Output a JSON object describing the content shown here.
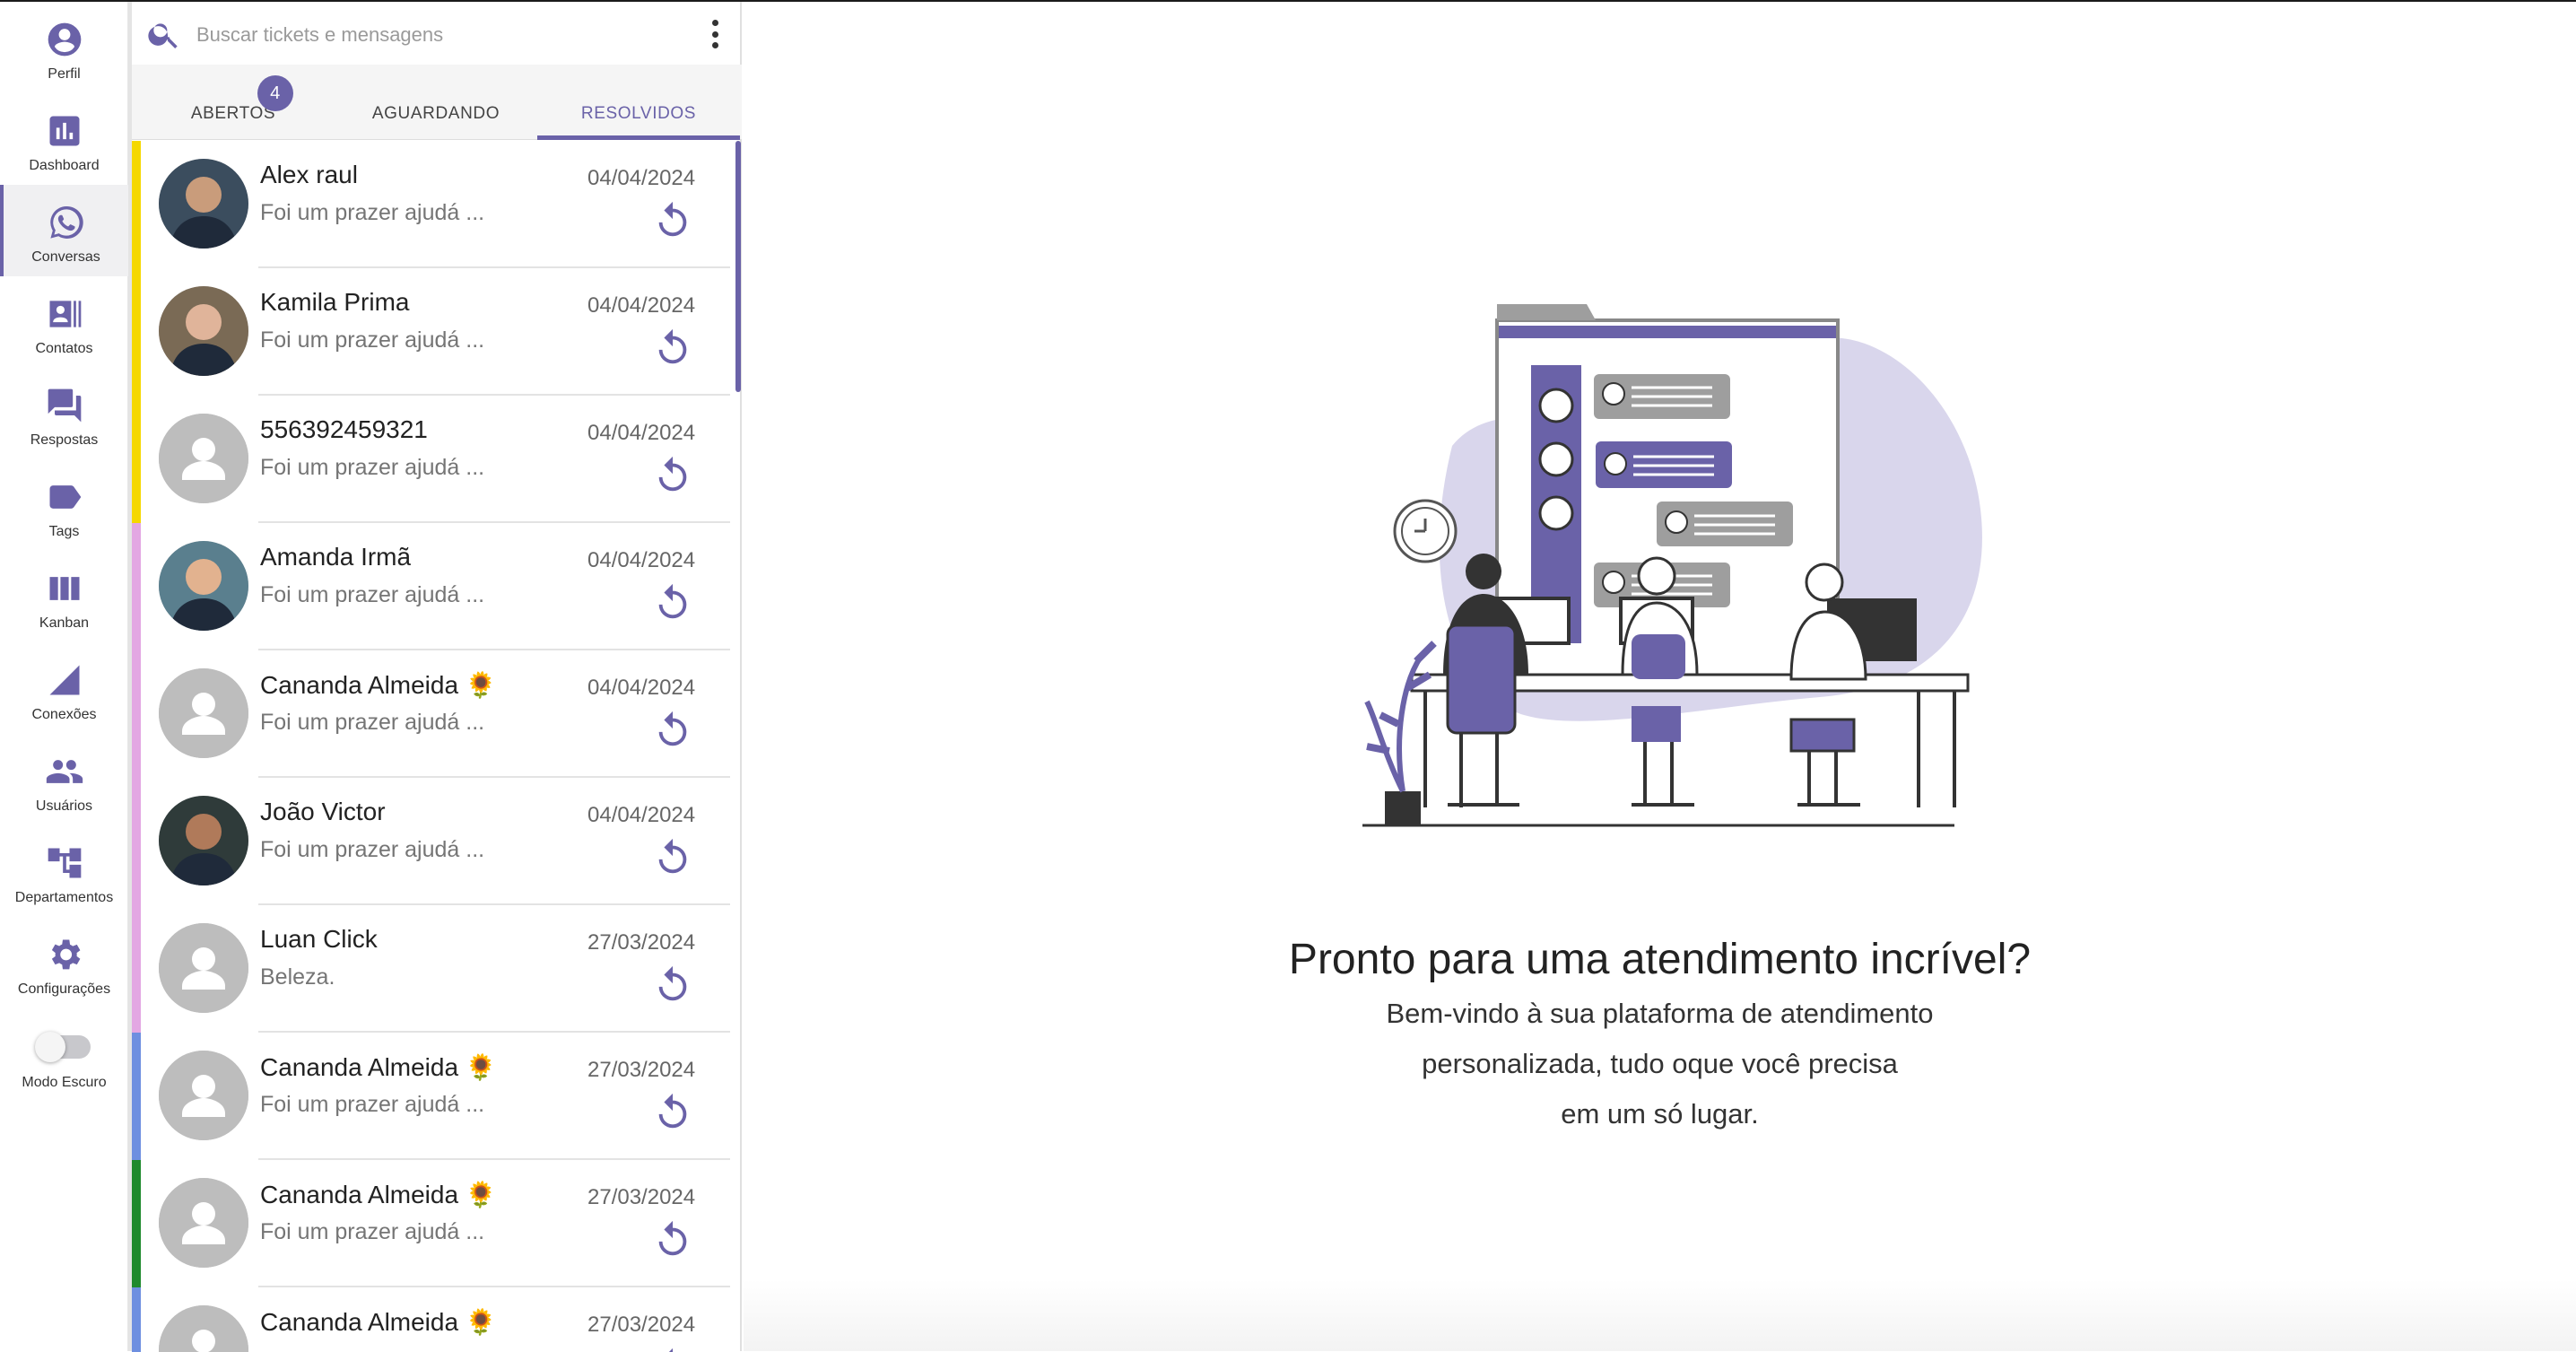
{
  "sidebar": {
    "items": [
      {
        "label": "Perfil",
        "icon": "user-circle-icon"
      },
      {
        "label": "Dashboard",
        "icon": "bar-chart-icon"
      },
      {
        "label": "Conversas",
        "icon": "whatsapp-icon"
      },
      {
        "label": "Contatos",
        "icon": "contacts-icon"
      },
      {
        "label": "Respostas",
        "icon": "chat-bubbles-icon"
      },
      {
        "label": "Tags",
        "icon": "tag-icon"
      },
      {
        "label": "Kanban",
        "icon": "kanban-icon"
      },
      {
        "label": "Conexões",
        "icon": "signal-icon"
      },
      {
        "label": "Usuários",
        "icon": "users-icon"
      },
      {
        "label": "Departamentos",
        "icon": "tree-icon"
      },
      {
        "label": "Configurações",
        "icon": "gear-icon"
      },
      {
        "label": "Modo Escuro",
        "icon": "toggle-icon"
      }
    ],
    "active": "Conversas",
    "dark_mode": false
  },
  "search": {
    "placeholder": "Buscar tickets e mensagens"
  },
  "tabs": [
    {
      "label": "ABERTOS",
      "badge": "4"
    },
    {
      "label": "AGUARDANDO"
    },
    {
      "label": "RESOLVIDOS",
      "active": true
    }
  ],
  "tickets": [
    {
      "name": "Alex raul",
      "message": "Foi um prazer ajudá ...",
      "date": "04/04/2024",
      "color": "#f5d800",
      "avatar": "photo"
    },
    {
      "name": "Kamila Prima",
      "message": "Foi um prazer ajudá ...",
      "date": "04/04/2024",
      "color": "#f5d800",
      "avatar": "photo"
    },
    {
      "name": "556392459321",
      "message": "Foi um prazer ajudá ...",
      "date": "04/04/2024",
      "color": "#f5d800",
      "avatar": "default"
    },
    {
      "name": "Amanda Irmã",
      "message": "Foi um prazer ajudá ...",
      "date": "04/04/2024",
      "color": "#e3a7e3",
      "avatar": "photo"
    },
    {
      "name": "Cananda Almeida 🌻",
      "message": "Foi um prazer ajudá ...",
      "date": "04/04/2024",
      "color": "#e3a7e3",
      "avatar": "default"
    },
    {
      "name": "João Victor",
      "message": "Foi um prazer ajudá ...",
      "date": "04/04/2024",
      "color": "#e3a7e3",
      "avatar": "photo"
    },
    {
      "name": "Luan Click",
      "message": "Beleza.",
      "date": "27/03/2024",
      "color": "#e3a7e3",
      "avatar": "default"
    },
    {
      "name": "Cananda Almeida 🌻",
      "message": "Foi um prazer ajudá ...",
      "date": "27/03/2024",
      "color": "#6e8fe0",
      "avatar": "default"
    },
    {
      "name": "Cananda Almeida 🌻",
      "message": "Foi um prazer ajudá ...",
      "date": "27/03/2024",
      "color": "#1f8a2d",
      "avatar": "default"
    },
    {
      "name": "Cananda Almeida 🌻",
      "message": "",
      "date": "27/03/2024",
      "color": "#6e8fe0",
      "avatar": "default"
    }
  ],
  "welcome": {
    "title": "Pronto para uma atendimento incrível?",
    "line1": "Bem-vindo à sua plataforma de atendimento",
    "line2": "personalizada, tudo oque você precisa",
    "line3": "em um só lugar."
  },
  "colors": {
    "accent": "#6a62a8",
    "blob": "#d9d6ec"
  }
}
